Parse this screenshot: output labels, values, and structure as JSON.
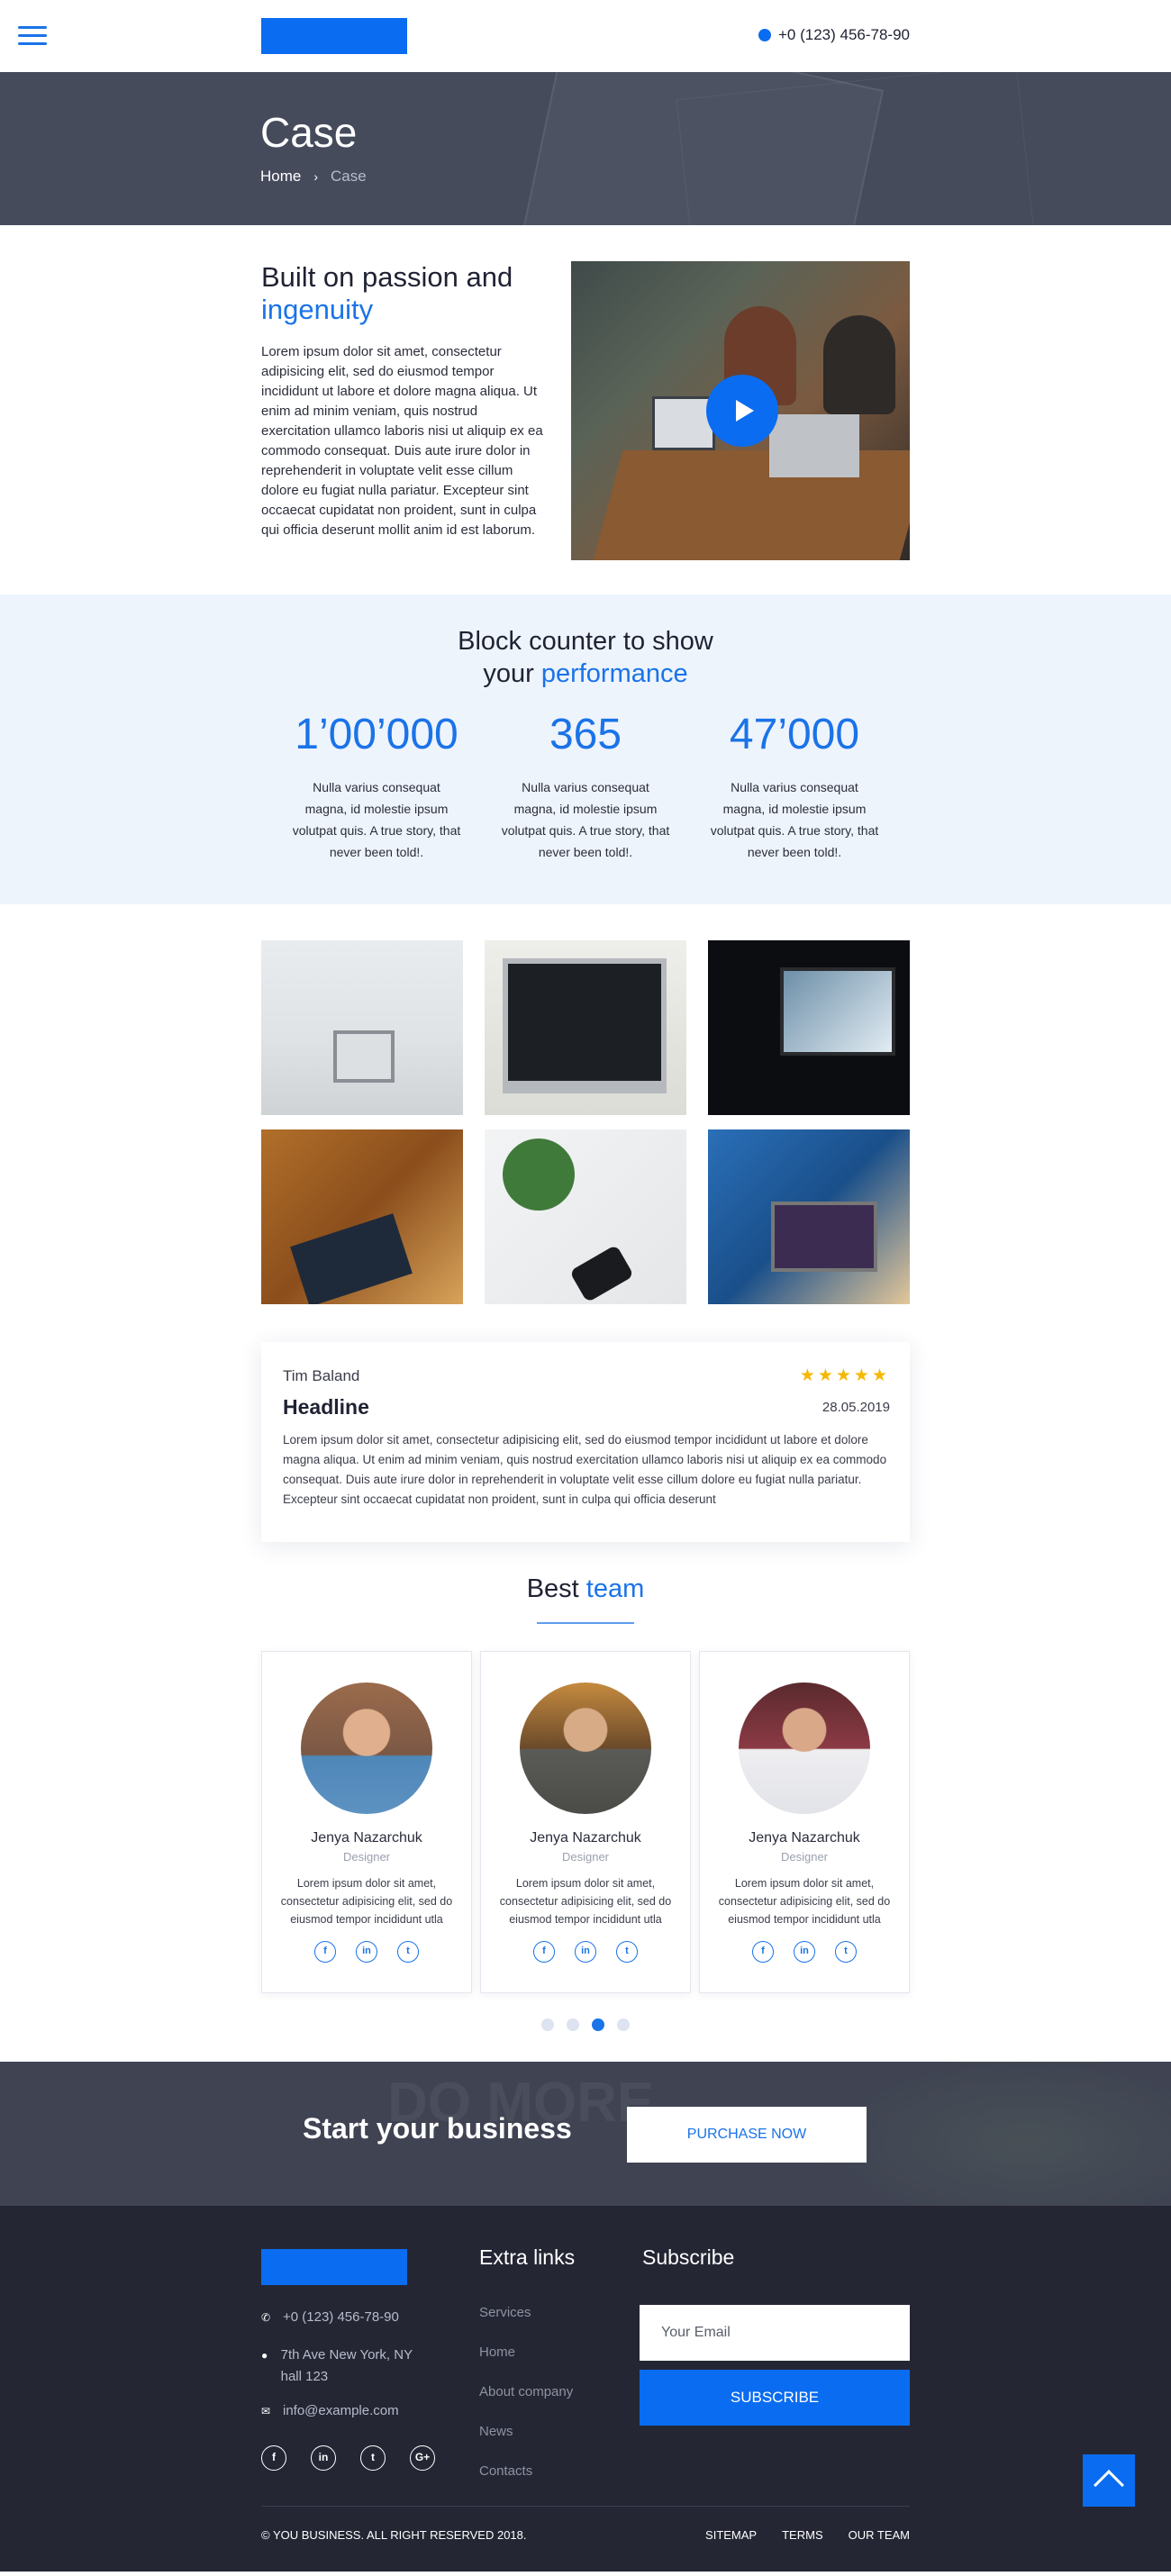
{
  "header": {
    "phone": "+0 (123) 456-78-90"
  },
  "hero": {
    "title": "Case",
    "crumb_home": "Home",
    "crumb_sep": "›",
    "crumb_current": "Case"
  },
  "about": {
    "title_line1": "Built on passion and",
    "title_accent": "ingenuity",
    "body": "Lorem ipsum dolor sit amet, consectetur adipisicing elit, sed do eiusmod tempor incididunt ut labore et dolore magna aliqua. Ut enim ad minim veniam, quis nostrud exercitation ullamco laboris nisi ut aliquip ex ea commodo consequat. Duis aute irure dolor in reprehenderit in voluptate velit esse cillum dolore eu fugiat nulla pariatur. Excepteur sint occaecat cupidatat non proident, sunt in culpa qui officia deserunt mollit anim id est laborum."
  },
  "counter": {
    "title_line1": "Block counter to show",
    "title_line2_prefix": "your ",
    "title_accent": "performance",
    "items": [
      {
        "value": "1’00’000",
        "desc": "Nulla varius consequat magna, id molestie ipsum volutpat quis. A true story, that never been told!."
      },
      {
        "value": "365",
        "desc": "Nulla varius consequat magna, id molestie ipsum volutpat quis. A true story, that never been told!."
      },
      {
        "value": "47’000",
        "desc": "Nulla varius consequat magna, id molestie ipsum volutpat quis. A true story, that never been told!."
      }
    ]
  },
  "review": {
    "name": "Tim Baland",
    "stars": "★★★★★",
    "headline": "Headline",
    "date": "28.05.2019",
    "body": "Lorem ipsum dolor sit amet, consectetur adipisicing elit, sed do eiusmod tempor incididunt ut labore et dolore magna aliqua. Ut enim ad minim veniam, quis nostrud exercitation ullamco laboris nisi ut aliquip ex ea commodo consequat. Duis aute irure dolor in reprehenderit in voluptate velit esse cillum dolore eu fugiat nulla pariatur. Excepteur sint occaecat cupidatat non proident, sunt in culpa qui officia deserunt"
  },
  "team": {
    "title_prefix": "Best ",
    "title_accent": "team",
    "members": [
      {
        "name": "Jenya Nazarchuk",
        "role": "Designer",
        "text": "Lorem ipsum dolor sit amet, consectetur adipisicing elit, sed do eiusmod tempor incididunt utla"
      },
      {
        "name": "Jenya Nazarchuk",
        "role": "Designer",
        "text": "Lorem ipsum dolor sit amet, consectetur adipisicing elit, sed do eiusmod tempor incididunt utla"
      },
      {
        "name": "Jenya Nazarchuk",
        "role": "Designer",
        "text": "Lorem ipsum dolor sit amet, consectetur adipisicing elit, sed do eiusmod tempor incididunt utla"
      }
    ],
    "social": {
      "facebook": "f",
      "linkedin": "in",
      "twitter": "t"
    },
    "active_dot": 3,
    "dot_count": 4
  },
  "cta": {
    "title": "Start your business",
    "button": "PURCHASE NOW",
    "bg_text": "DO MORE"
  },
  "footer": {
    "phone": "+0 (123) 456-78-90",
    "address": "7th Ave New York, NY hall 123",
    "email": "info@example.com",
    "social": {
      "facebook": "f",
      "linkedin": "in",
      "twitter": "t",
      "google": "G+"
    },
    "links_title": "Extra links",
    "links": [
      "Services",
      "Home",
      "About company",
      "News",
      "Contacts"
    ],
    "subscribe_title": "Subscribe",
    "email_placeholder": "Your Email",
    "subscribe_button": "SUBSCRIBE",
    "copyright": "© YOU BUSINESS. ALL RIGHT RESERVED 2018.",
    "bottom_links": [
      "SITEMAP",
      "TERMS",
      "OUR TEAM"
    ]
  },
  "colors": {
    "accent": "#1a73e8",
    "brand": "#0a6cf0",
    "dark": "#242634",
    "star": "#f5b700"
  }
}
